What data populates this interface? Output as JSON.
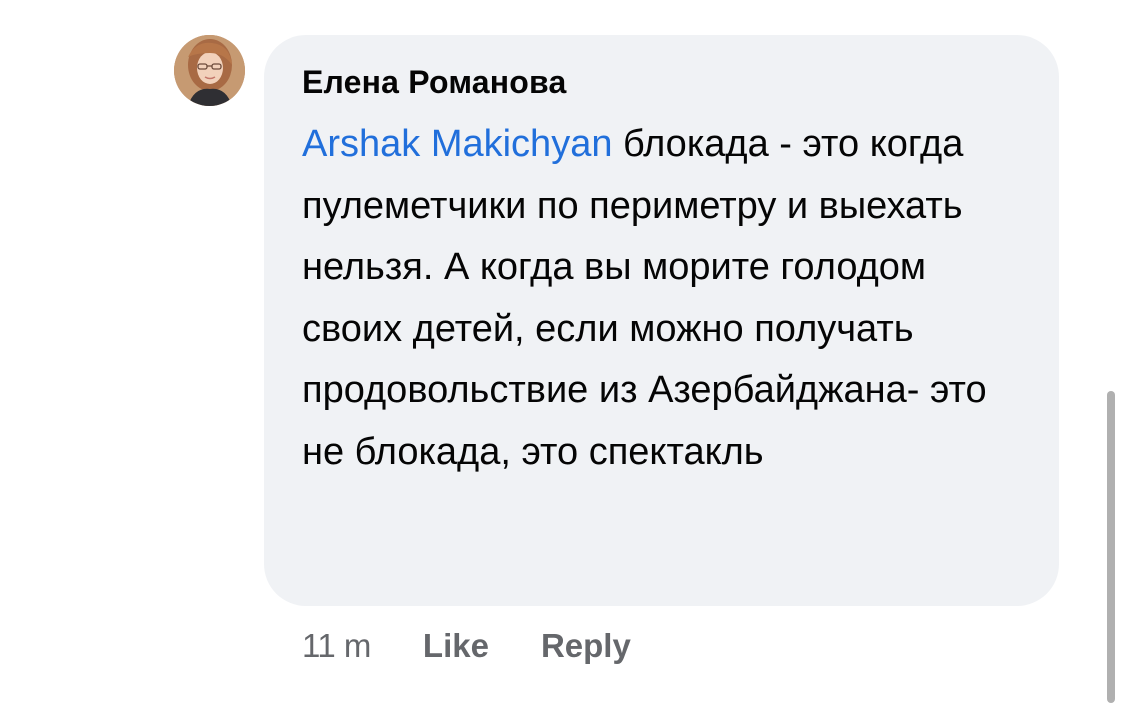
{
  "comment": {
    "author": "Елена Романова",
    "mention": "Arshak Makichyan",
    "text": " блокада - это когда пулеметчики по периметру и выехать нельзя. А когда вы морите голодом своих детей, если можно получать продовольствие из Азербайджана- это не блокада, это спектакль",
    "timestamp": "11 m",
    "actions": {
      "like": "Like",
      "reply": "Reply"
    }
  },
  "colors": {
    "bubble": "#f0f2f5",
    "mention": "#216fdb",
    "meta": "#65676b",
    "text": "#050505"
  }
}
